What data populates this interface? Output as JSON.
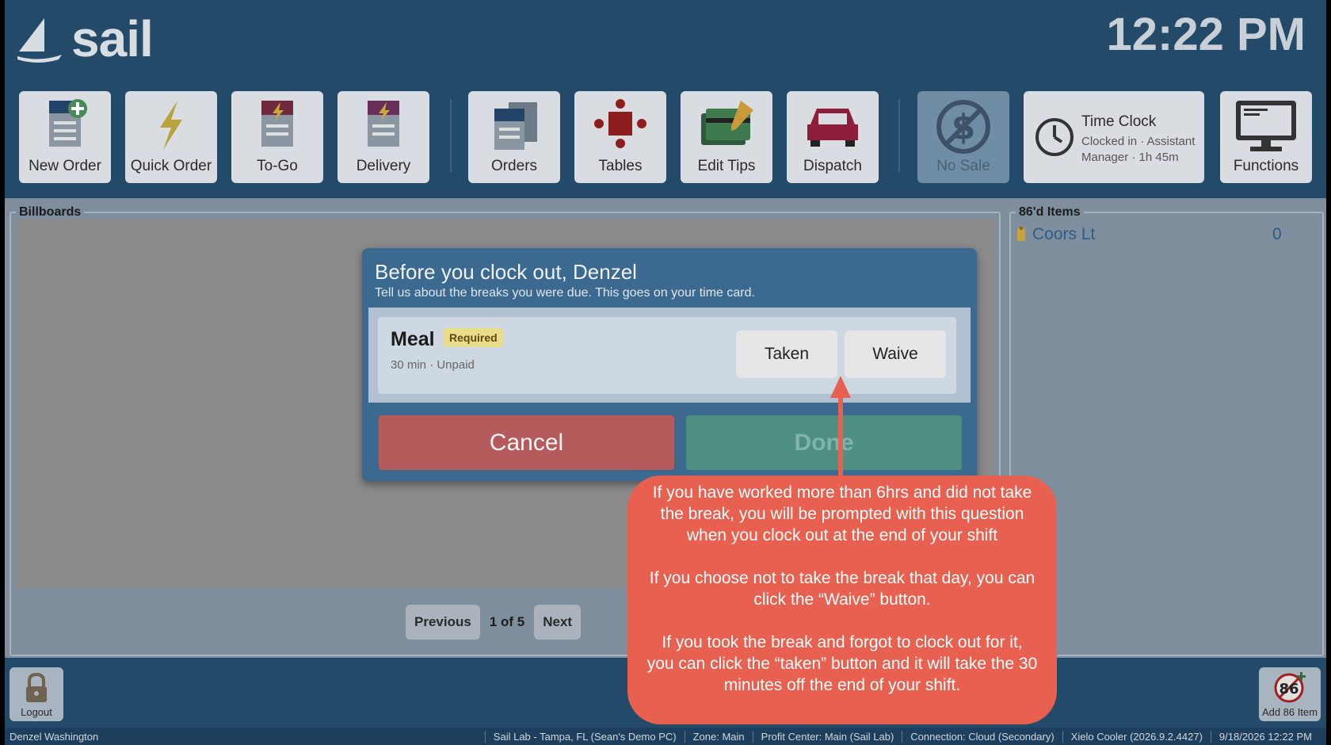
{
  "app": {
    "name": "sail",
    "time": "12:22 PM"
  },
  "toolbar": {
    "new_order": "New Order",
    "quick_order": "Quick Order",
    "to_go": "To-Go",
    "delivery": "Delivery",
    "orders": "Orders",
    "tables": "Tables",
    "edit_tips": "Edit Tips",
    "dispatch": "Dispatch",
    "no_sale": "No Sale",
    "time_clock": {
      "title": "Time Clock",
      "status": "Clocked in · Assistant Manager · 1h 45m"
    },
    "functions": "Functions"
  },
  "billboards": {
    "title": "Billboards",
    "pager": {
      "previous": "Previous",
      "info": "1 of 5",
      "next": "Next"
    }
  },
  "items86": {
    "title": "86'd Items",
    "items": [
      {
        "name": "Coors Lt",
        "count": "0"
      }
    ]
  },
  "bottom": {
    "logout": "Logout",
    "add86": "Add 86 Item"
  },
  "status": {
    "user": "Denzel Washington",
    "location": "Sail Lab - Tampa, FL (Sean's Demo PC)",
    "zone": "Zone: Main",
    "profit_center": "Profit Center: Main (Sail Lab)",
    "connection": "Connection: Cloud (Secondary)",
    "version": "Xielo Cooler (2026.9.2.4427)",
    "datetime": "9/18/2026 12:22 PM"
  },
  "dialog": {
    "title": "Before you clock out, Denzel",
    "subtitle": "Tell us about the breaks you were due. This goes on your time card.",
    "break": {
      "name": "Meal",
      "badge": "Required",
      "meta": "30 min · Unpaid",
      "taken": "Taken",
      "waive": "Waive"
    },
    "cancel": "Cancel",
    "done": "Done"
  },
  "annotation": {
    "p1": "If you have worked more than 6hrs and did not take the break, you will be prompted with this question when you clock out at the end of your shift",
    "p2": "If you choose not to take the break that day, you can click the “Waive” button.",
    "p3": "If you took the break and forgot to clock out for it, you can click the “taken” button and it will take the 30 minutes off the end of your shift."
  },
  "colors": {
    "header_bg": "#244a6a",
    "cancel": "#b55b5b",
    "done": "#4f8f82",
    "callout": "#e8604f"
  }
}
